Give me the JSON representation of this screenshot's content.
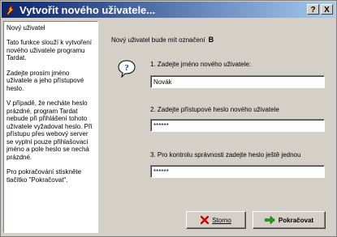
{
  "window": {
    "title": "Vytvořit nového uživatele...",
    "title_icon": "wizard-lightning-icon",
    "help_button": "?",
    "close_button": "X"
  },
  "sidebar": {
    "heading": "Nový uživatel",
    "paragraphs": [
      "Tato funkce slouží k vytvoření nového uživatele programu Tardat.",
      "Zadejte prosím jméno uživatele a jeho přístupové heslo.",
      "V případě, že necháte heslo prázdné, program Tardat nebude při přihlášení tohoto uživatele vyžadovat heslo. Při přístupu přes webový server se vyplní pouze přihlašovací jméno a pole heslo se nechá prázdné.",
      "Pro pokračování stiskněte tlačítko \"Pokračovat\"."
    ]
  },
  "main": {
    "intro_text": "Nový uživatel bude mít označení",
    "user_mark": "B",
    "help_icon": "question-bubble-icon",
    "step1_label": "1. Zadejte jméno nového uživatele:",
    "step1_value": "Novák",
    "step2_label": "2. Zadejte přístupové heslo nového uživatele",
    "step2_value": "******",
    "step3_label": "3. Pro kontrolu správnosti zadejte heslo ještě jednou",
    "step3_value": "******"
  },
  "buttons": {
    "cancel_label": "Storno",
    "cancel_icon": "red-x-icon",
    "continue_label": "Pokračovat",
    "continue_icon": "green-arrow-right-icon"
  },
  "colors": {
    "title_gradient_start": "#0a246a",
    "title_gradient_end": "#a6caf0",
    "face": "#d4d0c8"
  }
}
